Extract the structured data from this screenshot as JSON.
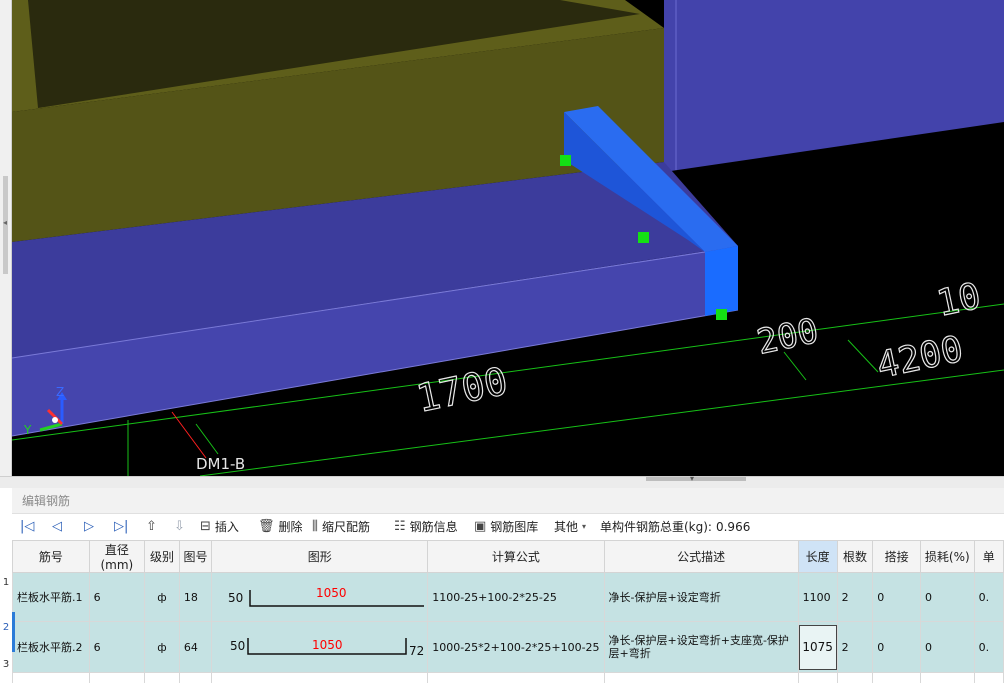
{
  "viewport": {
    "dim_labels": [
      "1700",
      "200",
      "4200",
      "10"
    ],
    "wall_label": "DM1-B",
    "axes": {
      "z": "Z",
      "y": "Y"
    }
  },
  "panel": {
    "title": "编辑钢筋",
    "toolbar": {
      "insert": "插入",
      "delete": "删除",
      "scale_rebar": "缩尺配筋",
      "rebar_info": "钢筋信息",
      "rebar_library": "钢筋图库",
      "other": "其他",
      "total_weight_label": "单构件钢筋总重(kg):",
      "total_weight_value": "0.966"
    }
  },
  "table": {
    "headers": [
      "筋号",
      "直径(mm)",
      "级别",
      "图号",
      "图形",
      "计算公式",
      "公式描述",
      "长度",
      "根数",
      "搭接",
      "损耗(%)",
      "单"
    ],
    "rows": [
      {
        "index": "1",
        "name": "栏板水平筋.1",
        "diameter": "6",
        "grade": "ф",
        "fig_no": "18",
        "shape_left": "50",
        "shape_mid": "1050",
        "shape_right": "",
        "formula": "1100-25+100-2*25-25",
        "desc": "净长-保护层+设定弯折",
        "length": "1100",
        "count": "2",
        "lap": "0",
        "loss": "0",
        "unit": "0."
      },
      {
        "index": "2",
        "name": "栏板水平筋.2",
        "diameter": "6",
        "grade": "ф",
        "fig_no": "64",
        "shape_left": "50",
        "shape_mid": "1050",
        "shape_right": "72",
        "formula": "1000-25*2+100-2*25+100-25",
        "desc": "净长-保护层+设定弯折+支座宽-保护层+弯折",
        "length": "1075",
        "count": "2",
        "lap": "0",
        "loss": "0",
        "unit": "0."
      },
      {
        "index": "3"
      }
    ]
  },
  "colors": {
    "olive": "#545417",
    "wall_blue": "#4545ad",
    "bright_blue": "#1a5fe8",
    "grip_green": "#14e014",
    "dim_green": "#17c017",
    "row_teal": "#c5e2e3",
    "shape_red": "#ff0000"
  }
}
